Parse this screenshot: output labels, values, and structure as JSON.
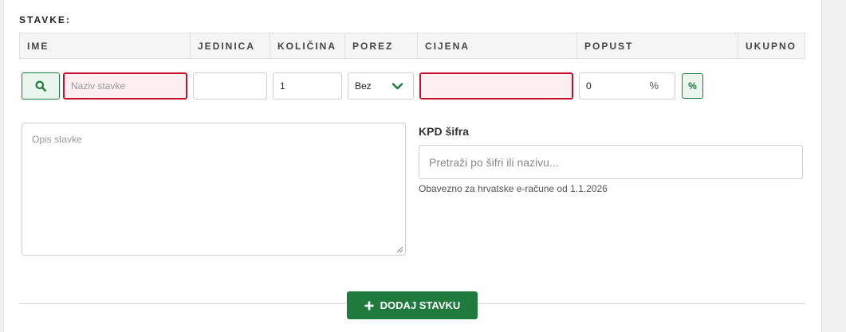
{
  "section": {
    "title": "STAVKE:"
  },
  "table": {
    "columns": [
      {
        "id": "ime",
        "label": "IME"
      },
      {
        "id": "jedinica",
        "label": "JEDINICA"
      },
      {
        "id": "kolicina",
        "label": "KOLIČINA"
      },
      {
        "id": "porez",
        "label": "POREZ"
      },
      {
        "id": "cijena",
        "label": "CIJENA"
      },
      {
        "id": "popust",
        "label": "POPUST"
      },
      {
        "id": "ukupno",
        "label": "UKUPNO"
      }
    ]
  },
  "row": {
    "search_icon": "search-icon",
    "name_placeholder": "Naziv stavke",
    "unit_value": "",
    "quantity_value": "1",
    "tax_selected": "Bez",
    "price_value": "",
    "discount_value": "0",
    "discount_suffix": "%",
    "percent_toggle": "%"
  },
  "description": {
    "placeholder": "Opis stavke"
  },
  "kpd": {
    "label": "KPD šifra",
    "placeholder": "Pretraži po šifri ili nazivu...",
    "help": "Obavezno za hrvatske e-račune od 1.1.2026"
  },
  "actions": {
    "add_label": "DODAJ STAVKU"
  },
  "colors": {
    "accent": "#1f7a3e",
    "error": "#c8102e",
    "error_bg": "#fdeef0"
  }
}
